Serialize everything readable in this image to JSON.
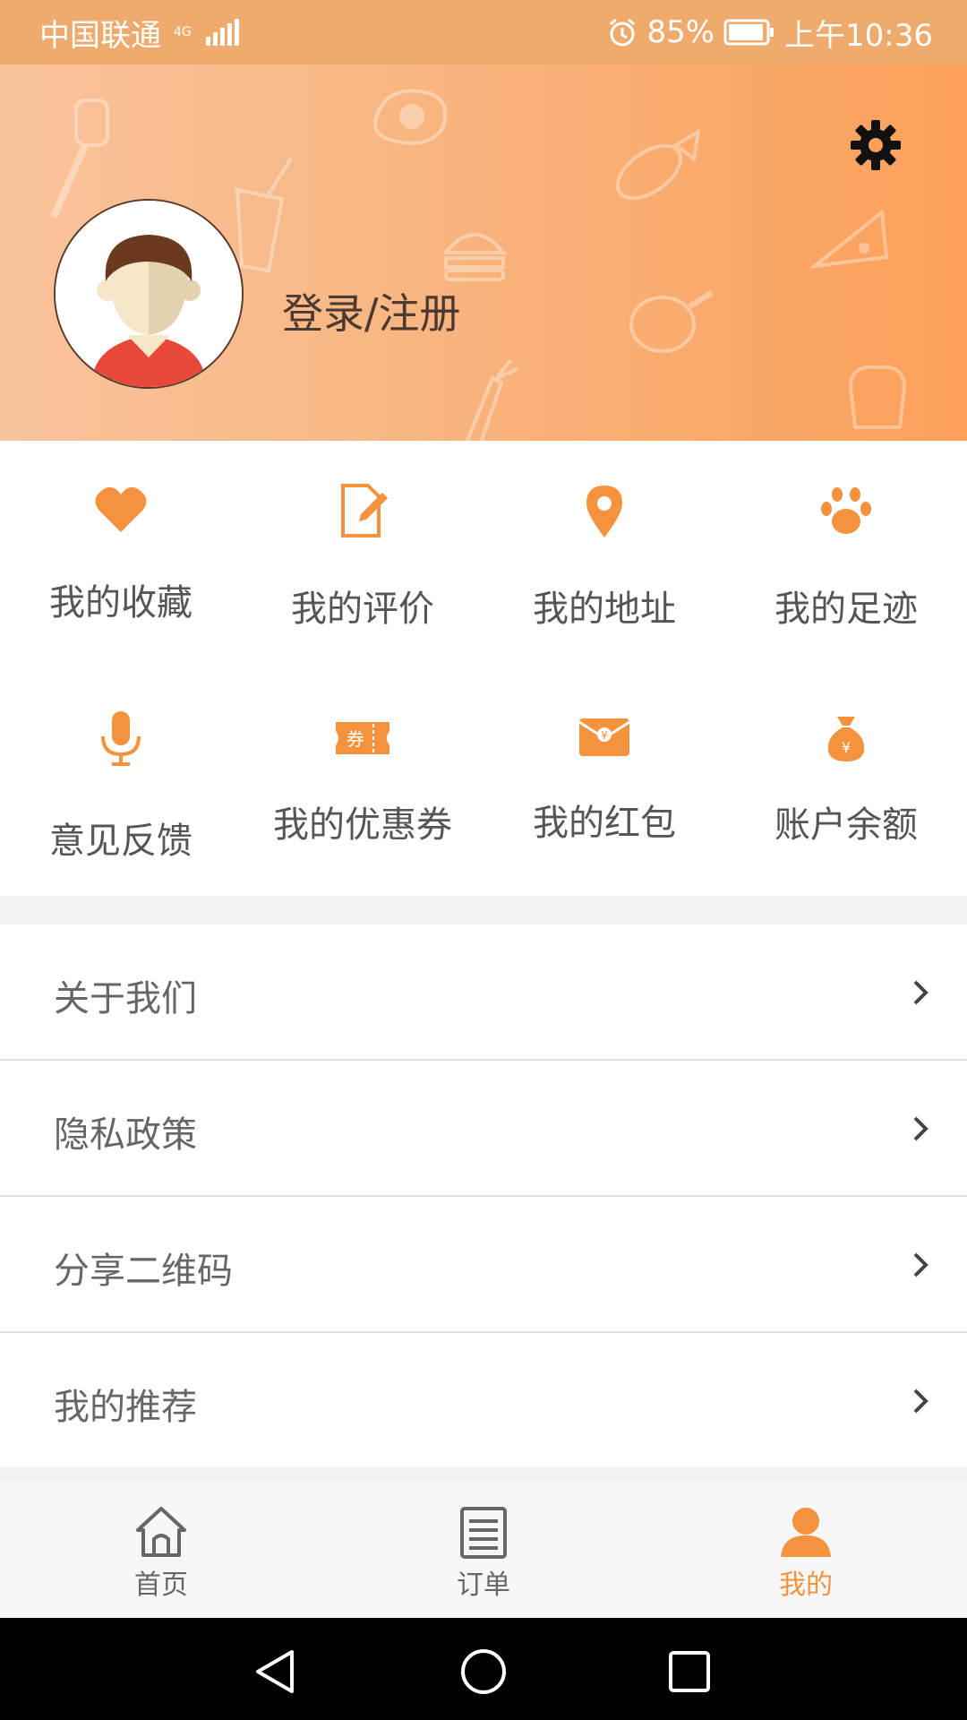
{
  "status_bar": {
    "carrier": "中国联通",
    "network": "4G",
    "battery": "85%",
    "time": "上午10:36"
  },
  "header": {
    "login_text": "登录/注册"
  },
  "grid": [
    {
      "label": "我的收藏",
      "icon": "heart-icon"
    },
    {
      "label": "我的评价",
      "icon": "edit-document-icon"
    },
    {
      "label": "我的地址",
      "icon": "location-pin-icon"
    },
    {
      "label": "我的足迹",
      "icon": "paw-icon"
    },
    {
      "label": "意见反馈",
      "icon": "microphone-icon"
    },
    {
      "label": "我的优惠券",
      "icon": "coupon-icon",
      "badge": "券"
    },
    {
      "label": "我的红包",
      "icon": "red-envelope-icon",
      "badge": "¥"
    },
    {
      "label": "账户余额",
      "icon": "money-bag-icon",
      "badge": "¥"
    }
  ],
  "menu": [
    {
      "label": "关于我们"
    },
    {
      "label": "隐私政策"
    },
    {
      "label": "分享二维码"
    },
    {
      "label": "我的推荐"
    }
  ],
  "tabs": [
    {
      "label": "首页",
      "icon": "home-icon"
    },
    {
      "label": "订单",
      "icon": "orders-icon"
    },
    {
      "label": "我的",
      "icon": "profile-icon",
      "active": true
    }
  ],
  "colors": {
    "accent": "#f5923e",
    "header_start": "#f9c49c",
    "header_end": "#fca05a",
    "status_bar": "#efaa6e"
  }
}
